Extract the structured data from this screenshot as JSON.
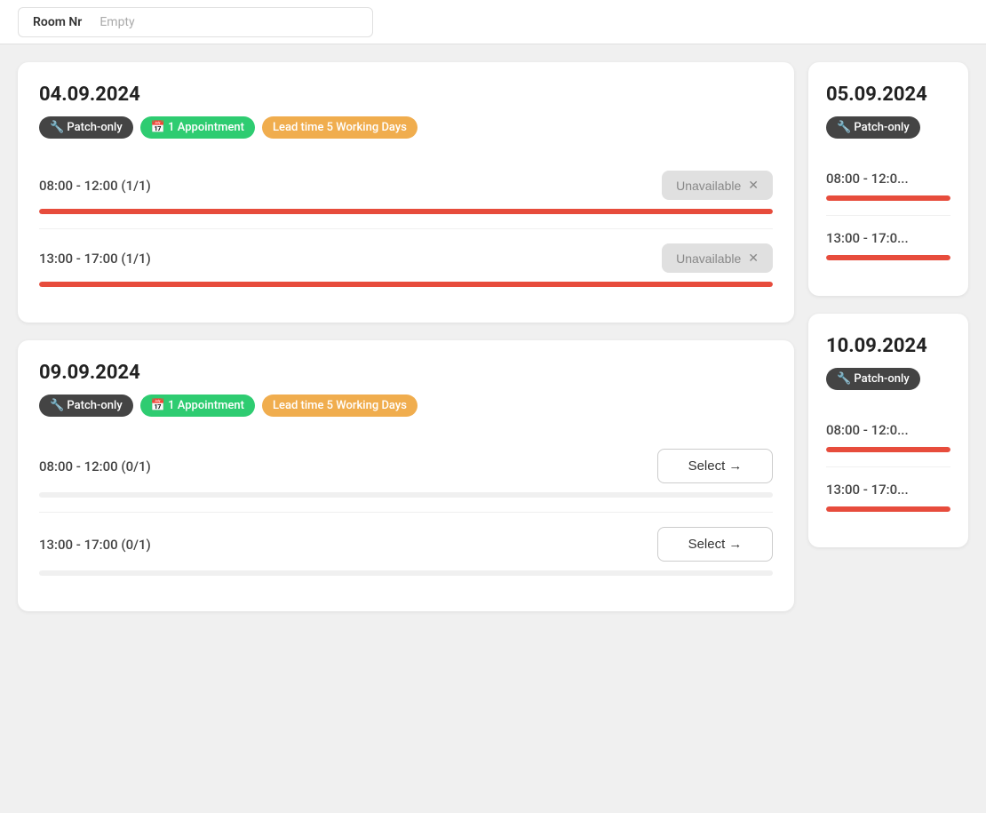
{
  "topbar": {
    "room_label": "Room Nr",
    "room_value": "Empty"
  },
  "cards": [
    {
      "id": "card-04-09-2024",
      "date": "04.09.2024",
      "badges": [
        {
          "label": "Patch-only",
          "type": "dark",
          "icon": "🔧"
        },
        {
          "label": "1 Appointment",
          "type": "green",
          "icon": "📅"
        },
        {
          "label": "Lead time 5 Working Days",
          "type": "yellow",
          "icon": ""
        }
      ],
      "slots": [
        {
          "time": "08:00 - 12:00 (1/1)",
          "status": "unavailable",
          "progress": 100,
          "progress_type": "red"
        },
        {
          "time": "13:00 - 17:00 (1/1)",
          "status": "unavailable",
          "progress": 100,
          "progress_type": "red"
        }
      ]
    },
    {
      "id": "card-09-09-2024",
      "date": "09.09.2024",
      "badges": [
        {
          "label": "Patch-only",
          "type": "dark",
          "icon": "🔧"
        },
        {
          "label": "1 Appointment",
          "type": "green",
          "icon": "📅"
        },
        {
          "label": "Lead time 5 Working Days",
          "type": "yellow",
          "icon": ""
        }
      ],
      "slots": [
        {
          "time": "08:00 - 12:00 (0/1)",
          "status": "select",
          "progress": 0,
          "progress_type": "gray"
        },
        {
          "time": "13:00 - 17:00 (0/1)",
          "status": "select",
          "progress": 0,
          "progress_type": "gray"
        }
      ]
    }
  ],
  "side_cards": [
    {
      "id": "side-card-05-09-2024",
      "date": "05.09.2024",
      "badges": [
        {
          "label": "Patch-only",
          "type": "dark",
          "icon": "🔧"
        }
      ],
      "slots": [
        {
          "time": "08:00 - 12:0...",
          "progress": 100,
          "progress_type": "red"
        },
        {
          "time": "13:00 - 17:0...",
          "progress": 100,
          "progress_type": "red"
        }
      ]
    },
    {
      "id": "side-card-10-09-2024",
      "date": "10.09.2024",
      "badges": [
        {
          "label": "Patch-only",
          "type": "dark",
          "icon": "🔧"
        }
      ],
      "slots": [
        {
          "time": "08:00 - 12:0...",
          "progress": 100,
          "progress_type": "red"
        },
        {
          "time": "13:00 - 17:0...",
          "progress": 100,
          "progress_type": "red"
        }
      ]
    }
  ],
  "buttons": {
    "unavailable_label": "Unavailable",
    "unavailable_x": "✕",
    "select_label": "Select",
    "select_arrow": "→"
  }
}
